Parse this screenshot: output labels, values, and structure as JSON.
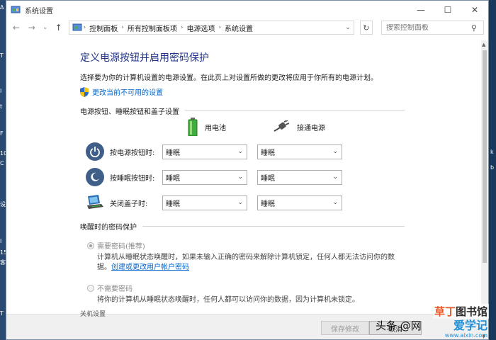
{
  "window": {
    "title": "系统设置",
    "controls": {
      "minimize": "—",
      "maximize": "☐",
      "close": "✕"
    }
  },
  "address_bar": {
    "back": "←",
    "forward": "→",
    "recent": "⌄",
    "up": "↑",
    "breadcrumbs": [
      "控制面板",
      "所有控制面板项",
      "电源选项",
      "系统设置"
    ],
    "dropdown": "⌄",
    "refresh": "↻",
    "search_placeholder": "搜索控制面板"
  },
  "main": {
    "title": "定义电源按钮并启用密码保护",
    "description": "选择要为你的计算机设置的电源设置。在此页上对设置所做的更改将应用于你所有的电源计划。",
    "change_unavailable_link": "更改当前不可用的设置",
    "power_section_title": "电源按钮、睡眠按钮和盖子设置",
    "columns": {
      "battery": "用电池",
      "plugged_in": "接通电源"
    },
    "rows": [
      {
        "label": "按电源按钮时:",
        "battery": "睡眠",
        "plugged_in": "睡眠"
      },
      {
        "label": "按睡眠按钮时:",
        "battery": "睡眠",
        "plugged_in": "睡眠"
      },
      {
        "label": "关闭盖子时:",
        "battery": "睡眠",
        "plugged_in": "睡眠"
      }
    ],
    "password_section_title": "唤醒时的密码保护",
    "require_password": {
      "label": "需要密码(推荐)",
      "description": "计算机从睡眠状态唤醒时，如果未输入正确的密码来解除计算机锁定，任何人都无法访问你的数",
      "description_end": "据。",
      "link": "创建或更改用户帐户密码"
    },
    "no_password": {
      "label": "不需要密码",
      "description": "将你的计算机从睡眠状态唤醒时，任何人都可以访问你的数据，因为计算机未锁定。"
    },
    "cut_off_section": "关机设置"
  },
  "footer": {
    "save": "保存修改",
    "cancel": "取消"
  },
  "watermark": {
    "line1_a": "草丁",
    "line1_b": "图书馆",
    "line2": "爱学记",
    "source": "头条 @网",
    "url": "www.aixin.com"
  },
  "desktop_left_glyphs": [
    "A",
    "T",
    "I",
    "t",
    "F",
    "10",
    "C",
    "设",
    "I",
    "15",
    "客",
    "T"
  ],
  "desktop_right_glyphs": [
    "k",
    "b"
  ],
  "colors": {
    "heading": "#1e3287",
    "link": "#0066cc",
    "battery_green": "#3fae3c",
    "power_icon": "#3f5f88"
  },
  "icons": {
    "title": "control-panel-icon",
    "shield": "uac-shield-icon",
    "battery": "battery-icon",
    "plug": "plug-icon",
    "row_icons": [
      "power-button-icon",
      "sleep-button-icon",
      "laptop-lid-icon"
    ]
  }
}
